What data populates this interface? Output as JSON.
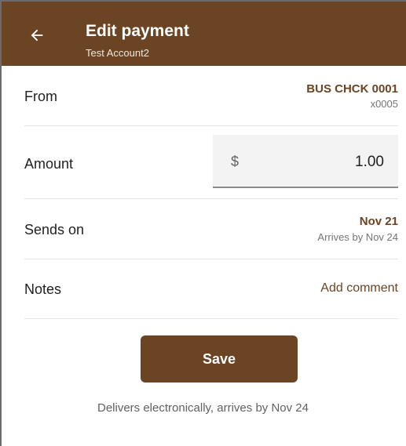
{
  "header": {
    "title": "Edit payment",
    "subtitle": "Test Account2",
    "back_icon": "arrow-left-icon"
  },
  "from": {
    "label": "From",
    "account_name": "BUS CHCK 0001",
    "account_mask": "x0005"
  },
  "amount": {
    "label": "Amount",
    "currency": "$",
    "value": "1.00"
  },
  "sends_on": {
    "label": "Sends on",
    "date": "Nov 21",
    "arrival": "Arrives by Nov 24"
  },
  "notes": {
    "label": "Notes",
    "action": "Add comment"
  },
  "save_label": "Save",
  "footnote": "Delivers electronically, arrives by Nov 24",
  "colors": {
    "brand": "#6b4423",
    "appbar_text": "#ffffff",
    "field_bg": "#f3f3f3"
  }
}
